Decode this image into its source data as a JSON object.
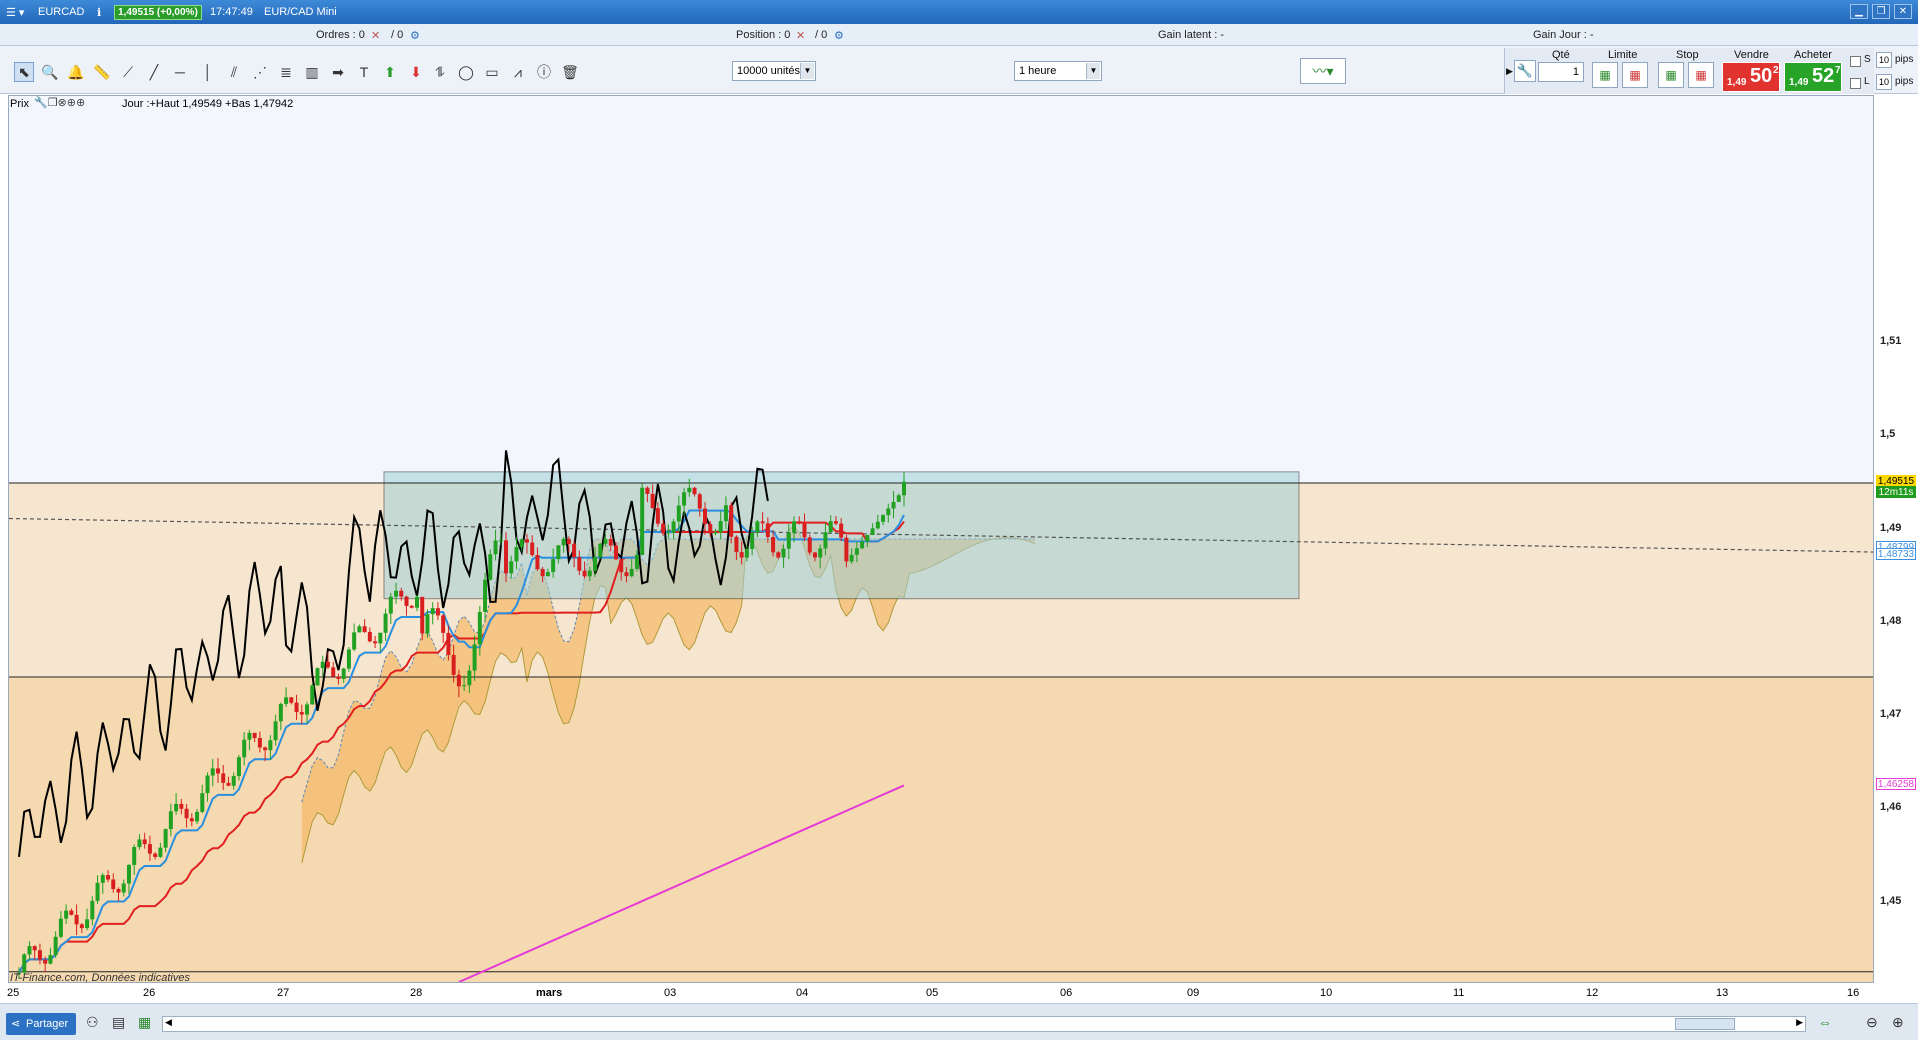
{
  "titlebar": {
    "symbol": "EURCAD",
    "price_badge": "1,49515 (+0,00%)",
    "time": "17:47:49",
    "instrument": "EUR/CAD Mini",
    "win_min": "▁",
    "win_max": "❐",
    "win_close": "✕"
  },
  "orders_bar": {
    "ordres": "Ordres : 0",
    "ordres_sep": "/ 0",
    "position": "Position : 0",
    "position_sep": "/ 0",
    "gain_latent": "Gain latent : -",
    "gain_jour": "Gain Jour : -"
  },
  "toolbar": {
    "units": "10000 unités",
    "interval": "1 heure",
    "qty_label": "Qté",
    "qty_value": "1",
    "limite_label": "Limite",
    "stop_label": "Stop",
    "sell_label": "Vendre",
    "buy_label": "Acheter",
    "sell_small": "1,49",
    "sell_big": "50",
    "sell_sup": "2",
    "buy_small": "1,49",
    "buy_big": "52",
    "buy_sup": "7",
    "s_label": "S",
    "l_label": "L",
    "s_value": "10",
    "l_value": "10",
    "pips1": "pips",
    "pips2": "pips",
    "tools": [
      "pointer-icon",
      "magnifier-icon",
      "alarm-bell-icon",
      "ruler-icon",
      "segment-icon",
      "line-icon",
      "horizontal-line-icon",
      "vertical-line-icon",
      "parallel-lines-icon",
      "fan-icon",
      "fibonacci-icon",
      "gann-icon",
      "arrow-icon",
      "text-icon",
      "up-arrow-icon",
      "down-arrow-icon",
      "channel-icon",
      "ellipse-icon",
      "rectangle-icon",
      "zigzag-icon",
      "info-icon",
      "trash-icon"
    ]
  },
  "chart_info": {
    "prix_label": "Prix",
    "day_text": "Jour :+Haut 1,49549 +Bas 1,47942"
  },
  "chart_data": {
    "type": "candlestick",
    "title": "",
    "instrument": "EUR/CAD Mini",
    "interval": "1 heure",
    "y_ticks": [
      "1,51",
      "1,5",
      "1,49",
      "1,48",
      "1,47",
      "1,46",
      "1,45"
    ],
    "y_tick_values": [
      1.51,
      1.5,
      1.49,
      1.48,
      1.47,
      1.46,
      1.45
    ],
    "ylim": [
      1.4415,
      1.5365
    ],
    "x_ticks": [
      "25",
      "26",
      "27",
      "28",
      "mars",
      "03",
      "04",
      "05",
      "06",
      "09",
      "10",
      "11",
      "12",
      "13",
      "16"
    ],
    "price_tags": [
      {
        "label": "1,49515",
        "value": 1.49515,
        "color": "#ffd800"
      },
      {
        "label": "12m11s",
        "value": 1.4939,
        "color": "#1f9c1f"
      },
      {
        "label": "1,48799",
        "value": 1.48799,
        "color": "#3d8fe0"
      },
      {
        "label": "1,48733",
        "value": 1.48733,
        "color": "#3d8fe0"
      },
      {
        "label": "1,46258",
        "value": 1.46258,
        "color": "#e63ad6"
      }
    ],
    "horizontal_lines": [
      1.495,
      1.4742,
      1.4426
    ],
    "zone": {
      "ymin": 1.4826,
      "ymax": 1.4962
    },
    "watermark": "IT-Finance.com, Données indicatives",
    "last_price": 1.49515,
    "grid": false
  },
  "bottombar": {
    "share": "Partager"
  },
  "colors": {
    "bull": "#21a121",
    "bear": "#d81e1e",
    "kijun": "#e02020",
    "tenkan": "#2b8fe0",
    "chikou": "#000000",
    "ma": "#e63ad6"
  }
}
